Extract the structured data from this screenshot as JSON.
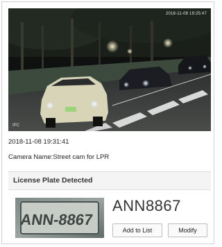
{
  "camera": {
    "overlay_timestamp": "2018-11-08 19:25:47",
    "overlay_label": "IPC"
  },
  "event": {
    "time": "2018-11-08 19:31:41",
    "camera_name_label": "Camera Name:",
    "camera_name": "Street cam for LPR"
  },
  "plate_section": {
    "title": "License Plate Detected",
    "plate_number": "ANN8867",
    "plate_image_text": "ANN-8867",
    "buttons": {
      "add_to_list": "Add to List",
      "modify": "Modify"
    }
  }
}
